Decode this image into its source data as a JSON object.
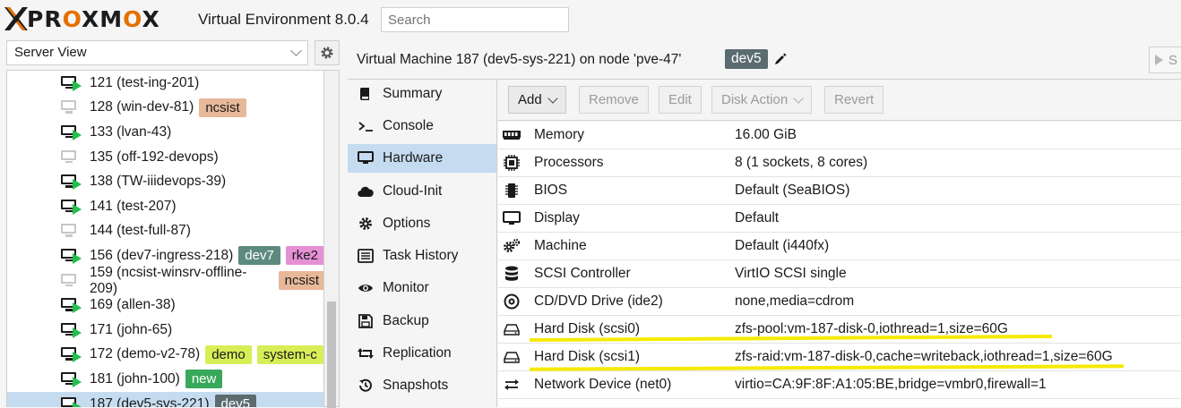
{
  "header": {
    "brand": "PROXMOX",
    "version": "Virtual Environment 8.0.4",
    "search_placeholder": "Search"
  },
  "left": {
    "view": "Server View",
    "tree": [
      {
        "label": "121 (test-ing-201)",
        "running": true,
        "tags": []
      },
      {
        "label": "128 (win-dev-81)",
        "running": false,
        "tags": [
          {
            "text": "ncsist",
            "cls": "t-ncsist"
          }
        ]
      },
      {
        "label": "133 (lvan-43)",
        "running": true,
        "tags": []
      },
      {
        "label": "135 (off-192-devops)",
        "running": false,
        "tags": []
      },
      {
        "label": "138 (TW-iiidevops-39)",
        "running": true,
        "tags": []
      },
      {
        "label": "141 (test-207)",
        "running": true,
        "tags": []
      },
      {
        "label": "144 (test-full-87)",
        "running": false,
        "tags": []
      },
      {
        "label": "156 (dev7-ingress-218)",
        "running": true,
        "tags": [
          {
            "text": "dev7",
            "cls": "t-dev7"
          },
          {
            "text": "rke2",
            "cls": "t-rke2"
          }
        ]
      },
      {
        "label": "159 (ncsist-winsrv-offline-209)",
        "running": false,
        "tags": [
          {
            "text": "ncsist",
            "cls": "t-ncsist"
          }
        ]
      },
      {
        "label": "169 (allen-38)",
        "running": true,
        "tags": []
      },
      {
        "label": "171 (john-65)",
        "running": true,
        "tags": []
      },
      {
        "label": "172 (demo-v2-78)",
        "running": true,
        "tags": [
          {
            "text": "demo",
            "cls": "t-demo"
          },
          {
            "text": "system-c",
            "cls": "t-system"
          }
        ]
      },
      {
        "label": "181 (john-100)",
        "running": true,
        "tags": [
          {
            "text": "new",
            "cls": "t-new"
          }
        ]
      },
      {
        "label": "187 (dev5-sys-221)",
        "running": true,
        "selected": true,
        "tags": [
          {
            "text": "dev5",
            "cls": "t-dev5"
          }
        ]
      }
    ]
  },
  "vm": {
    "title": "Virtual Machine 187 (dev5-sys-221) on node 'pve-47'",
    "tag": "dev5",
    "start_label": "S"
  },
  "nav": [
    {
      "label": "Summary",
      "icon": "book-icon"
    },
    {
      "label": "Console",
      "icon": "terminal-icon"
    },
    {
      "label": "Hardware",
      "icon": "desktop-icon",
      "selected": true
    },
    {
      "label": "Cloud-Init",
      "icon": "cloud-icon"
    },
    {
      "label": "Options",
      "icon": "gear-icon"
    },
    {
      "label": "Task History",
      "icon": "list-icon"
    },
    {
      "label": "Monitor",
      "icon": "eye-icon"
    },
    {
      "label": "Backup",
      "icon": "floppy-icon"
    },
    {
      "label": "Replication",
      "icon": "retweet-icon"
    },
    {
      "label": "Snapshots",
      "icon": "history-icon"
    }
  ],
  "toolbar": {
    "add": "Add",
    "remove": "Remove",
    "edit": "Edit",
    "disk_action": "Disk Action",
    "revert": "Revert"
  },
  "hardware": [
    {
      "key": "Memory",
      "value": "16.00 GiB",
      "icon": "memory-icon"
    },
    {
      "key": "Processors",
      "value": "8 (1 sockets, 8 cores)",
      "icon": "cpu-icon"
    },
    {
      "key": "BIOS",
      "value": "Default (SeaBIOS)",
      "icon": "microchip-icon"
    },
    {
      "key": "Display",
      "value": "Default",
      "icon": "monitor-icon"
    },
    {
      "key": "Machine",
      "value": "Default (i440fx)",
      "icon": "cogs-icon"
    },
    {
      "key": "SCSI Controller",
      "value": "VirtIO SCSI single",
      "icon": "database-icon"
    },
    {
      "key": "CD/DVD Drive (ide2)",
      "value": "none,media=cdrom",
      "icon": "cdrom-icon"
    },
    {
      "key": "Hard Disk (scsi0)",
      "value": "zfs-pool:vm-187-disk-0,iothread=1,size=60G",
      "icon": "hdd-icon"
    },
    {
      "key": "Hard Disk (scsi1)",
      "value": "zfs-raid:vm-187-disk-0,cache=writeback,iothread=1,size=60G",
      "icon": "hdd-icon"
    },
    {
      "key": "Network Device (net0)",
      "value": "virtio=CA:9F:8F:A1:05:BE,bridge=vmbr0,firewall=1",
      "icon": "exchange-icon"
    }
  ],
  "colors": {
    "accent_orange": "#e57000",
    "selection": "#c5dcf0",
    "running_green": "#21bf4b",
    "highlight_yellow": "#f5ea00"
  }
}
